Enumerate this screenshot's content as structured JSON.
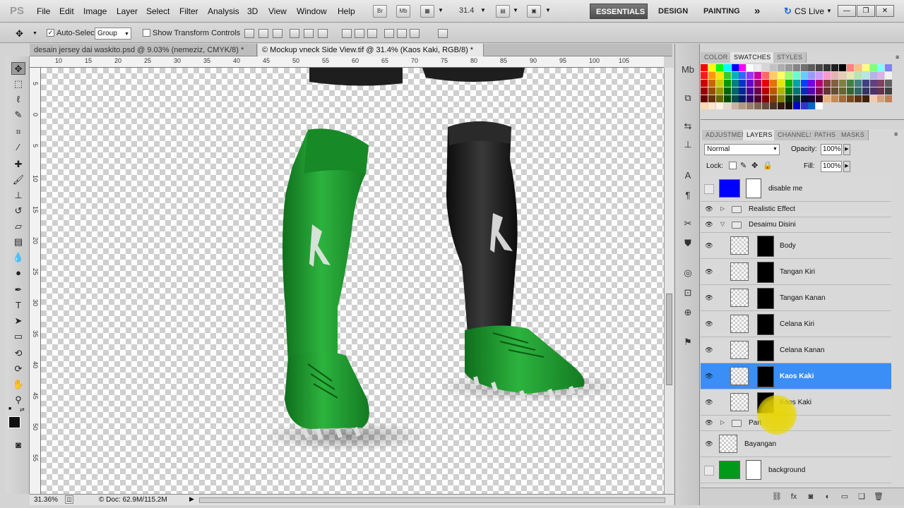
{
  "app": {
    "logo": "PS"
  },
  "menu": [
    "File",
    "Edit",
    "Image",
    "Layer",
    "Select",
    "Filter",
    "Analysis",
    "3D",
    "View",
    "Window",
    "Help"
  ],
  "menubar_buttons": {
    "bridge": "Br",
    "mini": "Mb"
  },
  "zoom_dropdown": "31.4",
  "workspaces": {
    "essentials": "ESSENTIALS",
    "design": "DESIGN",
    "painting": "PAINTING",
    "more": "»"
  },
  "cs_live": "CS Live",
  "window_controls": {
    "minimize": "—",
    "restore": "❐",
    "close": "✕"
  },
  "options": {
    "auto_select_label": "Auto-Select:",
    "auto_select_value": "Group",
    "show_transform": "Show Transform Controls"
  },
  "tabs": [
    {
      "label": "desain jersey dai waskito.psd @ 9.03% (nemeziz, CMYK/8) *",
      "close": "✕"
    },
    {
      "label": "© Mockup vneck Side View.tif @ 31.4% (Kaos Kaki, RGB/8) *",
      "close": "✕"
    }
  ],
  "ruler_ticks": [
    "10",
    "15",
    "20",
    "25",
    "30",
    "35",
    "40",
    "45",
    "50",
    "55",
    "60",
    "65",
    "70",
    "75",
    "80",
    "85",
    "90",
    "95",
    "100",
    "105"
  ],
  "ruler_ticks_v": [
    "5",
    "0",
    "5",
    "10",
    "15",
    "20",
    "25",
    "30",
    "35",
    "40",
    "45",
    "50",
    "55"
  ],
  "status": {
    "zoom": "31.36%",
    "doc": "Doc: 62.9M/115.2M"
  },
  "swatch_panel": {
    "tabs": [
      "COLOR",
      "SWATCHES",
      "STYLES"
    ],
    "active": "SWATCHES"
  },
  "swatch_colors": [
    "#ff0000",
    "#ffff00",
    "#00ff00",
    "#00ffff",
    "#0000ff",
    "#ff00ff",
    "#ffffff",
    "#ebebeb",
    "#d6d6d6",
    "#c2c2c2",
    "#adadad",
    "#999999",
    "#858585",
    "#707070",
    "#5c5c5c",
    "#474747",
    "#333333",
    "#1f1f1f",
    "#000000",
    "#ff8080",
    "#ffbf80",
    "#ffff80",
    "#80ff80",
    "#80ffff",
    "#8080ff",
    "#ff1a1a",
    "#ff9900",
    "#ffe600",
    "#33cc33",
    "#00b3b3",
    "#3366ff",
    "#9933ff",
    "#cc0099",
    "#ff6666",
    "#ffcc66",
    "#ffff66",
    "#99ff66",
    "#66ffcc",
    "#66ccff",
    "#9999ff",
    "#cc99ff",
    "#ff99cc",
    "#e6b3b3",
    "#e6ccb3",
    "#e6e6b3",
    "#b3e6b3",
    "#b3e6e6",
    "#b3b3e6",
    "#d9b3e6",
    "#f2f2f2",
    "#cc0000",
    "#cc6600",
    "#cccc00",
    "#009900",
    "#008080",
    "#0033cc",
    "#6600cc",
    "#990066",
    "#e60000",
    "#e67300",
    "#e6e600",
    "#00b300",
    "#00a3a3",
    "#0040ff",
    "#7300e6",
    "#b30077",
    "#804040",
    "#806040",
    "#808040",
    "#408040",
    "#408080",
    "#404080",
    "#604080",
    "#804060",
    "#606060",
    "#990000",
    "#994d00",
    "#999900",
    "#006600",
    "#006666",
    "#002699",
    "#4d0099",
    "#66004d",
    "#b30000",
    "#b35900",
    "#b3b300",
    "#008000",
    "#007373",
    "#002db3",
    "#5900b3",
    "#800055",
    "#663333",
    "#664d33",
    "#666633",
    "#336633",
    "#336666",
    "#333366",
    "#4d3366",
    "#66334d",
    "#404040",
    "#660000",
    "#663300",
    "#666600",
    "#004d00",
    "#004d4d",
    "#001a66",
    "#330066",
    "#4d0033",
    "#800000",
    "#804000",
    "#808000",
    "#003300",
    "#003333",
    "#000d33",
    "#1a0033",
    "#33001a",
    "#e6b380",
    "#c28c5a",
    "#a36b3a",
    "#7a4a1f",
    "#5c3312",
    "#3d2008",
    "#f2ccb3",
    "#d9a380",
    "#bf8059",
    "#ffd9b3",
    "#ffe6cc",
    "#fff2e6",
    "#e6d9cc",
    "#ccb3a3",
    "#b39980",
    "#99806b",
    "#806652",
    "#664d3d",
    "#4d3326",
    "#331a0d",
    "#1a0d00",
    "#0000cc",
    "#3333cc",
    "#0066cc",
    "#ffffff"
  ],
  "layers_panel": {
    "tabs": [
      "ADJUSTMEN",
      "LAYERS",
      "CHANNELS",
      "PATHS",
      "MASKS"
    ],
    "active": "LAYERS",
    "blend_mode": "Normal",
    "opacity_label": "Opacity:",
    "opacity": "100%",
    "lock_label": "Lock:",
    "fill_label": "Fill:",
    "fill": "100%"
  },
  "layers": [
    {
      "name": "disable me",
      "visible": false,
      "type": "fill",
      "thumb_color": "#0000ff"
    },
    {
      "name": "Realistic Effect",
      "visible": true,
      "type": "group",
      "expanded": false
    },
    {
      "name": "Desaimu Disini",
      "visible": true,
      "type": "group",
      "expanded": true
    },
    {
      "name": "Body",
      "visible": true,
      "type": "smart"
    },
    {
      "name": "Tangan Kiri",
      "visible": true,
      "type": "smart"
    },
    {
      "name": "Tangan Kanan",
      "visible": true,
      "type": "smart"
    },
    {
      "name": "Celana Kiri",
      "visible": true,
      "type": "smart"
    },
    {
      "name": "Celana Kanan",
      "visible": true,
      "type": "smart"
    },
    {
      "name": "Kaos Kaki",
      "visible": true,
      "type": "smart",
      "selected": true
    },
    {
      "name": "Kaos Kaki",
      "visible": true,
      "type": "smart"
    },
    {
      "name": "Part",
      "visible": true,
      "type": "group",
      "expanded": false
    },
    {
      "name": "Bayangan",
      "visible": true,
      "type": "pixel"
    },
    {
      "name": "background",
      "visible": false,
      "type": "fill",
      "thumb_color": "#009a1a"
    }
  ],
  "canvas_colors": {
    "green": "#1f9a2e",
    "black": "#1b1b1b",
    "selection": "#3a8ef5"
  }
}
